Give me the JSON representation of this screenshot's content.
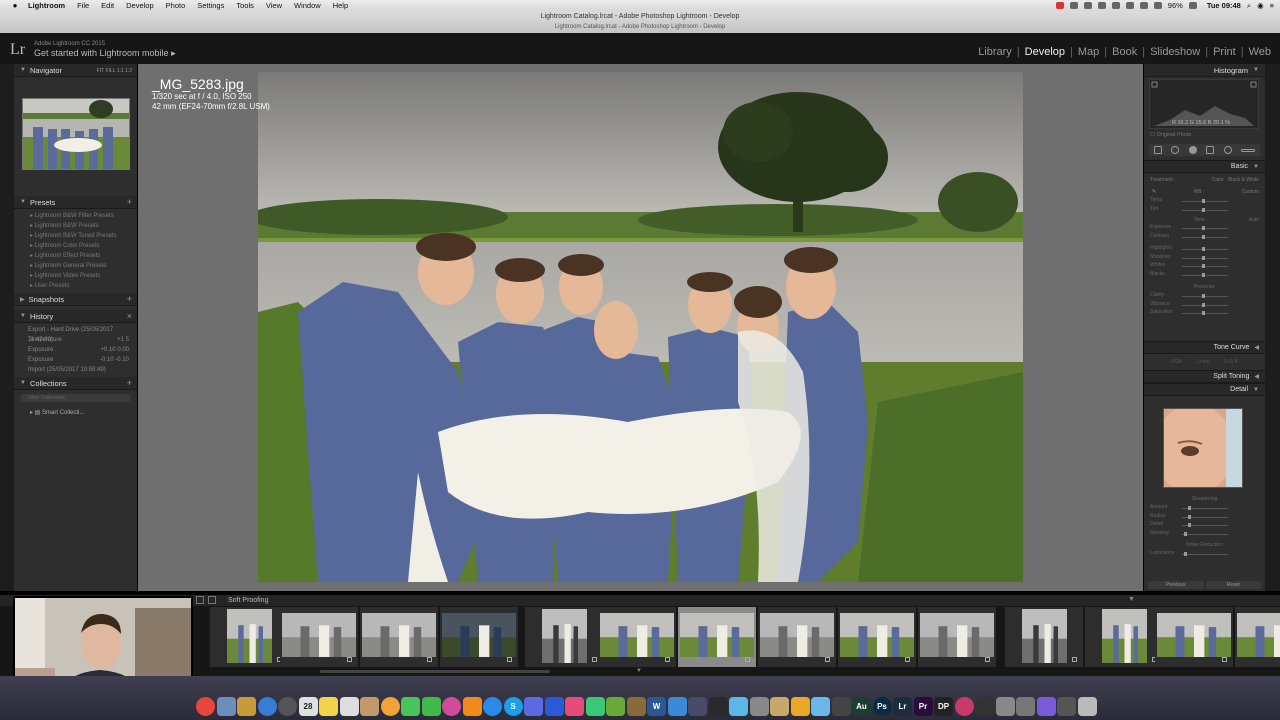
{
  "menubar": {
    "app_name": "Lightroom",
    "items": [
      "File",
      "Edit",
      "Develop",
      "Photo",
      "Settings",
      "Tools",
      "View",
      "Window",
      "Help"
    ],
    "battery": "96%",
    "clock": "Tue 09:48"
  },
  "window": {
    "title": "Lightroom Catalog.lrcat - Adobe Photoshop Lightroom - Develop",
    "subtitle": "Lightroom Catalog.lrcat - Adobe Photoshop Lightroom - Develop"
  },
  "identity": {
    "logo": "Lr",
    "product": "Adobe Lightroom CC 2015",
    "tagline": "Get started with Lightroom mobile",
    "arrow": "▸"
  },
  "modules": [
    "Library",
    "Develop",
    "Map",
    "Book",
    "Slideshow",
    "Print",
    "Web"
  ],
  "left_panel": {
    "navigator": {
      "title": "Navigator",
      "zoom": [
        "FIT",
        "FILL",
        "1:1",
        "1:2"
      ]
    },
    "presets": {
      "title": "Presets",
      "items": [
        "Lightroom B&W Filter Presets",
        "Lightroom B&W Presets",
        "Lightroom B&W Toned Presets",
        "Lightroom Color Presets",
        "Lightroom Effect Presets",
        "Lightroom General Presets",
        "Lightroom Video Presets",
        "User Presets"
      ]
    },
    "snapshots": {
      "title": "Snapshots"
    },
    "history": {
      "title": "History",
      "rows": [
        {
          "label": "Export - Hard Drive (25/05/2017 11:47:00)",
          "a": "",
          "b": ""
        },
        {
          "label": "Temperature",
          "a": "+1",
          "b": "5"
        },
        {
          "label": "Exposure",
          "a": "+0.10",
          "b": "0.00"
        },
        {
          "label": "Exposure",
          "a": "-0.10",
          "b": "-0.10"
        },
        {
          "label": "Import (25/05/2017 10:59:49)",
          "a": "",
          "b": ""
        }
      ]
    },
    "collections": {
      "title": "Collections",
      "search_placeholder": "Filter Collections",
      "items": [
        "Smart Collecti..."
      ]
    }
  },
  "right_panel": {
    "histogram": {
      "title": "Histogram",
      "readout": "R 16.2  G 15.6  B 20.1 %",
      "original": "Original Photo"
    },
    "basic": {
      "title": "Basic",
      "treatment_label": "Treatment :",
      "treatment_options": [
        "Color",
        "Black & White"
      ],
      "wb_label": "WB :",
      "wb_value": "Custom",
      "wb_sliders": [
        "Temp",
        "Tint"
      ],
      "tone_label": "Tone",
      "tone_auto": "Auto",
      "tone_sliders": [
        "Exposure",
        "Contrast",
        "Highlights",
        "Shadows",
        "Whites",
        "Blacks"
      ],
      "presence_label": "Presence",
      "presence_sliders": [
        "Clarity",
        "Vibrance",
        "Saturation"
      ]
    },
    "tone_curve": {
      "title": "Tone Curve",
      "channels": [
        "RGB",
        "Linear",
        "R G B"
      ]
    },
    "split_toning": {
      "title": "Split Toning"
    },
    "detail": {
      "title": "Detail",
      "sharpening_label": "Sharpening",
      "sharpening_sliders": [
        "Amount",
        "Radius",
        "Detail",
        "Masking"
      ],
      "noise_label": "Noise Reduction",
      "noise_sliders": [
        "Luminance"
      ]
    },
    "buttons": [
      "Previous",
      "Reset"
    ]
  },
  "viewer": {
    "filename": "_MG_5283.jpg",
    "exposure_line": "1/320 sec at f / 4.0, ISO 250",
    "lens_line": "42 mm (EF24-70mm f/2.8L USM)"
  },
  "filmstrip": {
    "label": "Soft Proofing",
    "thumbs": [
      {
        "theme": "green",
        "portrait": true
      },
      {
        "theme": "grey",
        "portrait": false
      },
      {
        "theme": "grey",
        "portrait": false
      },
      {
        "theme": "dark",
        "portrait": false
      },
      {
        "theme": "bw",
        "portrait": true
      },
      {
        "theme": "green",
        "portrait": false
      },
      {
        "theme": "green",
        "portrait": false,
        "selected": true
      },
      {
        "theme": "grey",
        "portrait": false
      },
      {
        "theme": "green",
        "portrait": false
      },
      {
        "theme": "grey",
        "portrait": false
      },
      {
        "theme": "bw",
        "portrait": true
      },
      {
        "theme": "green",
        "portrait": true
      },
      {
        "theme": "green",
        "portrait": false
      },
      {
        "theme": "green",
        "portrait": false
      }
    ]
  },
  "dock": {
    "icons": [
      {
        "name": "chrome-icon",
        "color": "#e8453c"
      },
      {
        "name": "preview-icon",
        "color": "#6b8fb8"
      },
      {
        "name": "finder-icon",
        "color": "#c79a3a"
      },
      {
        "name": "safari-icon",
        "color": "#3a7bd5"
      },
      {
        "name": "launchpad-icon",
        "color": "#555"
      },
      {
        "name": "calendar-icon",
        "color": "#e0e0e0",
        "label": "28"
      },
      {
        "name": "notes-icon",
        "color": "#f2d34a"
      },
      {
        "name": "textedit-icon",
        "color": "#ddd"
      },
      {
        "name": "contacts-icon",
        "color": "#c29a6a"
      },
      {
        "name": "photos-icon",
        "color": "#f1a33a"
      },
      {
        "name": "messages-icon",
        "color": "#4ac35a"
      },
      {
        "name": "facetime-icon",
        "color": "#3fb94a"
      },
      {
        "name": "itunes-icon",
        "color": "#d44a9a"
      },
      {
        "name": "ibooks-icon",
        "color": "#f08a1a"
      },
      {
        "name": "appstore-icon",
        "color": "#2a8ae8"
      },
      {
        "name": "skype-icon",
        "color": "#1aa0e8",
        "label": "S"
      },
      {
        "name": "app-icon-1",
        "color": "#5a6ae0"
      },
      {
        "name": "app-icon-2",
        "color": "#2a5ad8"
      },
      {
        "name": "app-icon-3",
        "color": "#e84a7a"
      },
      {
        "name": "app-icon-4",
        "color": "#3ac878"
      },
      {
        "name": "app-icon-5",
        "color": "#6aa83a"
      },
      {
        "name": "app-icon-6",
        "color": "#8a6a3a"
      },
      {
        "name": "word-icon",
        "color": "#2b5797",
        "label": "W"
      },
      {
        "name": "app-icon-7",
        "color": "#3a8ad8"
      },
      {
        "name": "app-icon-8",
        "color": "#4a4a6a"
      },
      {
        "name": "app-icon-9",
        "color": "#2a2a2a"
      },
      {
        "name": "app-icon-10",
        "color": "#5ab8e8"
      },
      {
        "name": "app-icon-11",
        "color": "#888"
      },
      {
        "name": "app-icon-12",
        "color": "#c8a86a"
      },
      {
        "name": "app-icon-13",
        "color": "#e8a82a"
      },
      {
        "name": "app-icon-14",
        "color": "#6ab8e8"
      },
      {
        "name": "app-icon-15",
        "color": "#444"
      },
      {
        "name": "audition-icon",
        "color": "#1d3c34",
        "label": "Au"
      },
      {
        "name": "photoshop-icon",
        "color": "#0b2a44",
        "label": "Ps"
      },
      {
        "name": "lightroom-icon",
        "color": "#1b2c3c",
        "label": "Lr"
      },
      {
        "name": "premiere-icon",
        "color": "#2a0b3c",
        "label": "Pr"
      },
      {
        "name": "app-icon-16",
        "color": "#222",
        "label": "DP"
      },
      {
        "name": "davinci-icon",
        "color": "#c83a6a"
      },
      {
        "name": "app-icon-17",
        "color": "#333"
      },
      {
        "name": "app-icon-18",
        "color": "#888"
      },
      {
        "name": "system-prefs-icon",
        "color": "#777"
      },
      {
        "name": "app-icon-19",
        "color": "#7a5ad8"
      },
      {
        "name": "downloads-icon",
        "color": "#555"
      },
      {
        "name": "trash-icon",
        "color": "#bbb"
      }
    ]
  }
}
